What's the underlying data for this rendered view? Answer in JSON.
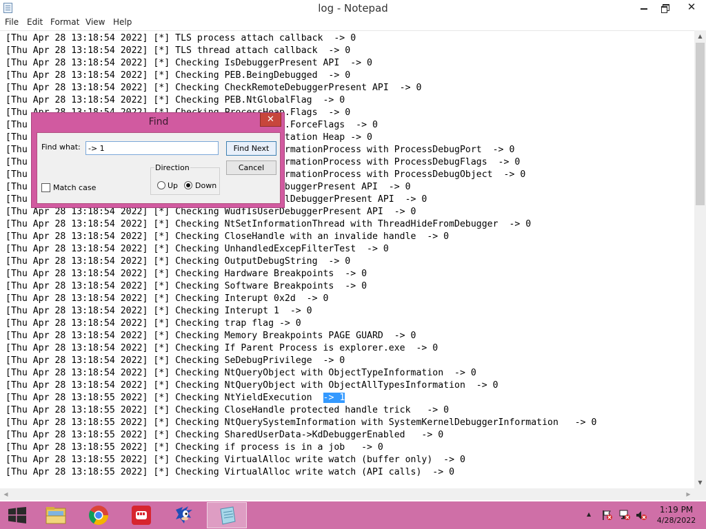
{
  "window": {
    "title": "log - Notepad",
    "minimize_icon": "minimize-icon",
    "restore_icon": "restore-icon",
    "close_glyph": "✕"
  },
  "menu": [
    "File",
    "Edit",
    "Format",
    "View",
    "Help"
  ],
  "editor": {
    "lines": [
      "[Thu Apr 28 13:18:54 2022] [*] TLS process attach callback  -> 0",
      "[Thu Apr 28 13:18:54 2022] [*] TLS thread attach callback  -> 0",
      "[Thu Apr 28 13:18:54 2022] [*] Checking IsDebuggerPresent API  -> 0",
      "[Thu Apr 28 13:18:54 2022] [*] Checking PEB.BeingDebugged  -> 0",
      "[Thu Apr 28 13:18:54 2022] [*] Checking CheckRemoteDebuggerPresent API  -> 0",
      "[Thu Apr 28 13:18:54 2022] [*] Checking PEB.NtGlobalFlag  -> 0",
      "[Thu Apr 28 13:18:54 2022] [*] Checking ProcessHeap.Flags  -> 0",
      "[Thu Apr 28 13:18:54 2022] [*] Checking ProcessHeap.ForceFlags  -> 0",
      "[Thu Apr 28 13:18:54 2022] [*] Checking Low Fragmentation Heap -> 0",
      "[Thu Apr 28 13:18:54 2022] [*] Checking NtQueryInformationProcess with ProcessDebugPort  -> 0",
      "[Thu Apr 28 13:18:54 2022] [*] Checking NtQueryInformationProcess with ProcessDebugFlags  -> 0",
      "[Thu Apr 28 13:18:54 2022] [*] Checking NtQueryInformationProcess with ProcessDebugObject  -> 0",
      "[Thu Apr 28 13:18:54 2022] [*] Checking WudfIsAnyDebuggerPresent API  -> 0",
      "[Thu Apr 28 13:18:54 2022] [*] Checking WudfIsKernelDebuggerPresent API  -> 0",
      "[Thu Apr 28 13:18:54 2022] [*] Checking WudfIsUserDebuggerPresent API  -> 0",
      "[Thu Apr 28 13:18:54 2022] [*] Checking NtSetInformationThread with ThreadHideFromDebugger  -> 0",
      "[Thu Apr 28 13:18:54 2022] [*] Checking CloseHandle with an invalide handle  -> 0",
      "[Thu Apr 28 13:18:54 2022] [*] Checking UnhandledExcepFilterTest  -> 0",
      "[Thu Apr 28 13:18:54 2022] [*] Checking OutputDebugString  -> 0",
      "[Thu Apr 28 13:18:54 2022] [*] Checking Hardware Breakpoints  -> 0",
      "[Thu Apr 28 13:18:54 2022] [*] Checking Software Breakpoints  -> 0",
      "[Thu Apr 28 13:18:54 2022] [*] Checking Interupt 0x2d  -> 0",
      "[Thu Apr 28 13:18:54 2022] [*] Checking Interupt 1  -> 0",
      "[Thu Apr 28 13:18:54 2022] [*] Checking trap flag -> 0",
      "[Thu Apr 28 13:18:54 2022] [*] Checking Memory Breakpoints PAGE GUARD  -> 0",
      "[Thu Apr 28 13:18:54 2022] [*] Checking If Parent Process is explorer.exe  -> 0",
      "[Thu Apr 28 13:18:54 2022] [*] Checking SeDebugPrivilege  -> 0",
      "[Thu Apr 28 13:18:54 2022] [*] Checking NtQueryObject with ObjectTypeInformation  -> 0",
      "[Thu Apr 28 13:18:54 2022] [*] Checking NtQueryObject with ObjectAllTypesInformation  -> 0",
      "[Thu Apr 28 13:18:55 2022] [*] Checking NtYieldExecution  ",
      "[Thu Apr 28 13:18:55 2022] [*] Checking CloseHandle protected handle trick   -> 0",
      "[Thu Apr 28 13:18:55 2022] [*] Checking NtQuerySystemInformation with SystemKernelDebuggerInformation   -> 0",
      "[Thu Apr 28 13:18:55 2022] [*] Checking SharedUserData->KdDebuggerEnabled   -> 0",
      "[Thu Apr 28 13:18:55 2022] [*] Checking if process is in a job   -> 0",
      "[Thu Apr 28 13:18:55 2022] [*] Checking VirtualAlloc write watch (buffer only)  -> 0",
      "[Thu Apr 28 13:18:55 2022] [*] Checking VirtualAlloc write watch (API calls)  -> 0"
    ],
    "highlight_line": 29,
    "highlight_text": "-> 1"
  },
  "find_dialog": {
    "title": "Find",
    "close_glyph": "✕",
    "find_what_label": "Find what:",
    "find_what_value": "-> 1",
    "find_next_label": "Find Next",
    "cancel_label": "Cancel",
    "direction_label": "Direction",
    "up_label": "Up",
    "down_label": "Down",
    "direction_selected": "Down",
    "match_case_label": "Match case",
    "match_case_checked": false
  },
  "scrollbars": {
    "up_glyph": "▲",
    "down_glyph": "▼",
    "left_glyph": "◀",
    "right_glyph": "▶"
  },
  "taskbar": {
    "apps": [
      {
        "name": "file-explorer",
        "icon": "folder-icon"
      },
      {
        "name": "chrome",
        "icon": "chrome-icon"
      },
      {
        "name": "reader",
        "icon": "fist-icon"
      },
      {
        "name": "sonic",
        "icon": "sonic-icon"
      },
      {
        "name": "notepad",
        "icon": "notepad-icon",
        "active": true
      }
    ],
    "tray_chevron": "▲",
    "time": "1:19 PM",
    "date": "4/28/2022"
  },
  "colors": {
    "accent": "#cf6fa7",
    "dialog_frame": "#d15aa0",
    "selection": "#3399ff",
    "close_red": "#c7463c"
  }
}
